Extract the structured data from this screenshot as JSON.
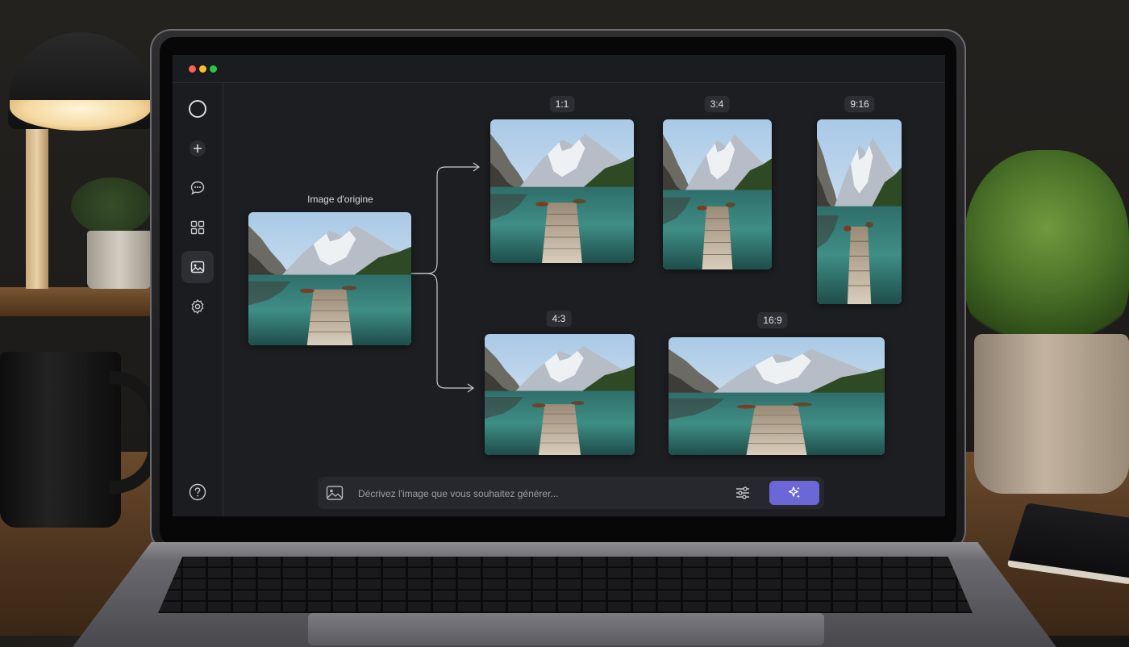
{
  "window": {
    "controls": [
      "close",
      "minimize",
      "maximize"
    ]
  },
  "sidebar": {
    "items": [
      {
        "icon": "circle-icon",
        "active": false
      },
      {
        "icon": "plus-icon",
        "active": false
      },
      {
        "icon": "chat-icon",
        "active": false
      },
      {
        "icon": "grid-icon",
        "active": false
      },
      {
        "icon": "image-icon",
        "active": true
      },
      {
        "icon": "gear-icon",
        "active": false
      }
    ],
    "help_icon": "help-icon"
  },
  "canvas": {
    "original_label": "Image d'origine",
    "variants": [
      {
        "ratio": "1:1"
      },
      {
        "ratio": "3:4"
      },
      {
        "ratio": "9:16"
      },
      {
        "ratio": "4:3"
      },
      {
        "ratio": "16:9"
      }
    ]
  },
  "prompt": {
    "placeholder": "Décrivez l'image que vous souhaitez générer...",
    "value": "",
    "image_icon": "image-icon",
    "settings_icon": "sliders-icon",
    "generate_icon": "sparkle-icon"
  },
  "colors": {
    "accent": "#6b67d6",
    "app_bg": "#1d1e22",
    "sidebar_bg": "#1b1c20",
    "badge_bg": "#2d2e34"
  }
}
